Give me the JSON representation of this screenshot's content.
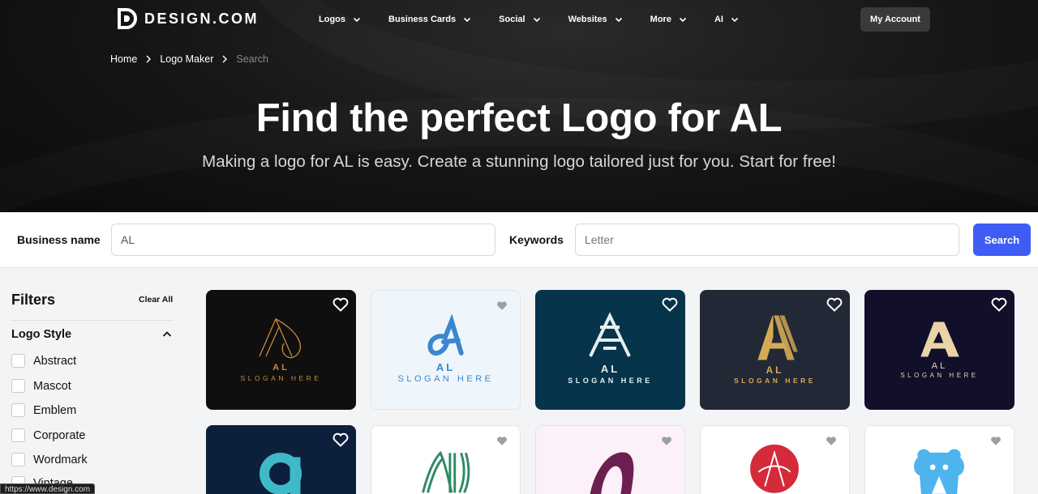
{
  "brand": {
    "name": "DESIGN.COM"
  },
  "nav": [
    {
      "label": "Logos"
    },
    {
      "label": "Business Cards"
    },
    {
      "label": "Social"
    },
    {
      "label": "Websites"
    },
    {
      "label": "More"
    },
    {
      "label": "AI"
    }
  ],
  "account": {
    "label": "My Account"
  },
  "breadcrumb": [
    "Home",
    "Logo Maker",
    "Search"
  ],
  "hero": {
    "title": "Find the perfect Logo for AL",
    "subtitle": "Making a logo for AL is easy. Create a stunning logo tailored just for you. Start for free!"
  },
  "search": {
    "business_label": "Business name",
    "business_value": "AL",
    "keywords_label": "Keywords",
    "keywords_placeholder": "Letter",
    "button": "Search"
  },
  "filters": {
    "title": "Filters",
    "clear_all": "Clear All",
    "group_title": "Logo Style",
    "options": [
      "Abstract",
      "Mascot",
      "Emblem",
      "Corporate",
      "Wordmark",
      "Vintage"
    ]
  },
  "status_url": "https://www.design.com",
  "cards_row1": [
    {
      "name": "AL",
      "slogan": "SLOGAN HERE",
      "bg": "#0f0f0f",
      "fg": "#c98a3e",
      "heart": "#ffffff"
    },
    {
      "name": "AL",
      "slogan": "SLOGAN HERE",
      "bg": "#eef6fb",
      "fg": "#3d86cf",
      "heart": "#9aa0a6"
    },
    {
      "name": "AL",
      "slogan": "SLOGAN HERE",
      "bg": "#06344a",
      "fg": "#e6edf0",
      "heart": "#ffffff"
    },
    {
      "name": "AL",
      "slogan": "SLOGAN HERE",
      "bg": "#232836",
      "fg": "#d6aa55",
      "heart": "#ffffff"
    },
    {
      "name": "AL",
      "slogan": "SLOGAN HERE",
      "bg": "#120f2b",
      "fg": "#e9d4a8",
      "heart": "#ffffff"
    }
  ],
  "cards_row2": [
    {
      "bg": "#0c1f3d",
      "fg": "#3fb9c8",
      "heart": "#ffffff"
    },
    {
      "bg": "#ffffff",
      "fg": "#2e8a64",
      "heart": "#9aa0a6"
    },
    {
      "bg": "#fcf1f8",
      "fg": "#6e1f52",
      "heart": "#9aa0a6"
    },
    {
      "bg": "#ffffff",
      "fg": "#d42a3a",
      "heart": "#9aa0a6"
    },
    {
      "bg": "#ffffff",
      "fg": "#4fb4ee",
      "heart": "#9aa0a6"
    }
  ]
}
